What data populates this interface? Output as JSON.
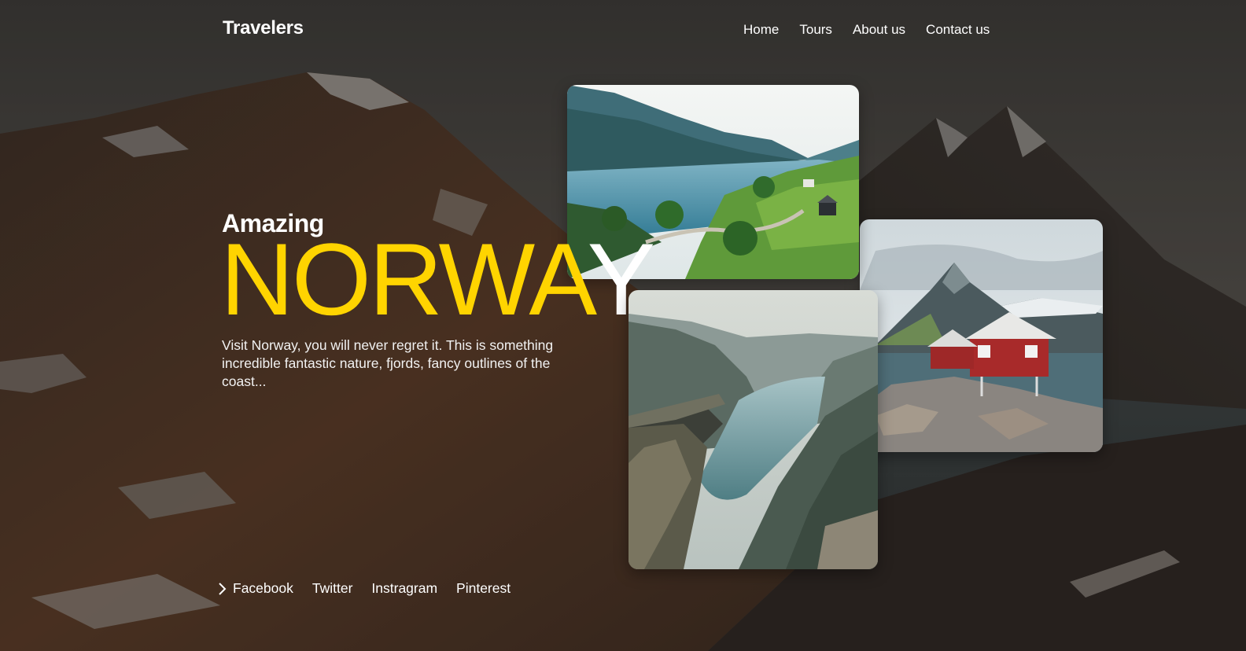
{
  "brand": {
    "logo": "Travelers"
  },
  "nav": [
    {
      "label": "Home"
    },
    {
      "label": "Tours"
    },
    {
      "label": "About us"
    },
    {
      "label": "Contact us"
    }
  ],
  "hero": {
    "kicker": "Amazing",
    "title_highlight": "NORWA",
    "title_rest": "Y",
    "description": "Visit Norway, you will never regret it. This is something incredible fantastic nature, fjords, fancy outlines of the coast..."
  },
  "gallery": [
    {
      "subject": "fjord valley with green hills"
    },
    {
      "subject": "red cabin on rocky shore"
    },
    {
      "subject": "cliff overlooking fjord"
    }
  ],
  "social": {
    "icon": "chevron-right-icon",
    "links": [
      {
        "label": "Facebook"
      },
      {
        "label": "Twitter"
      },
      {
        "label": "Instragram"
      },
      {
        "label": "Pinterest"
      }
    ]
  },
  "colors": {
    "accent": "#ffd400",
    "text": "#ffffff",
    "background": "#2a2522"
  }
}
